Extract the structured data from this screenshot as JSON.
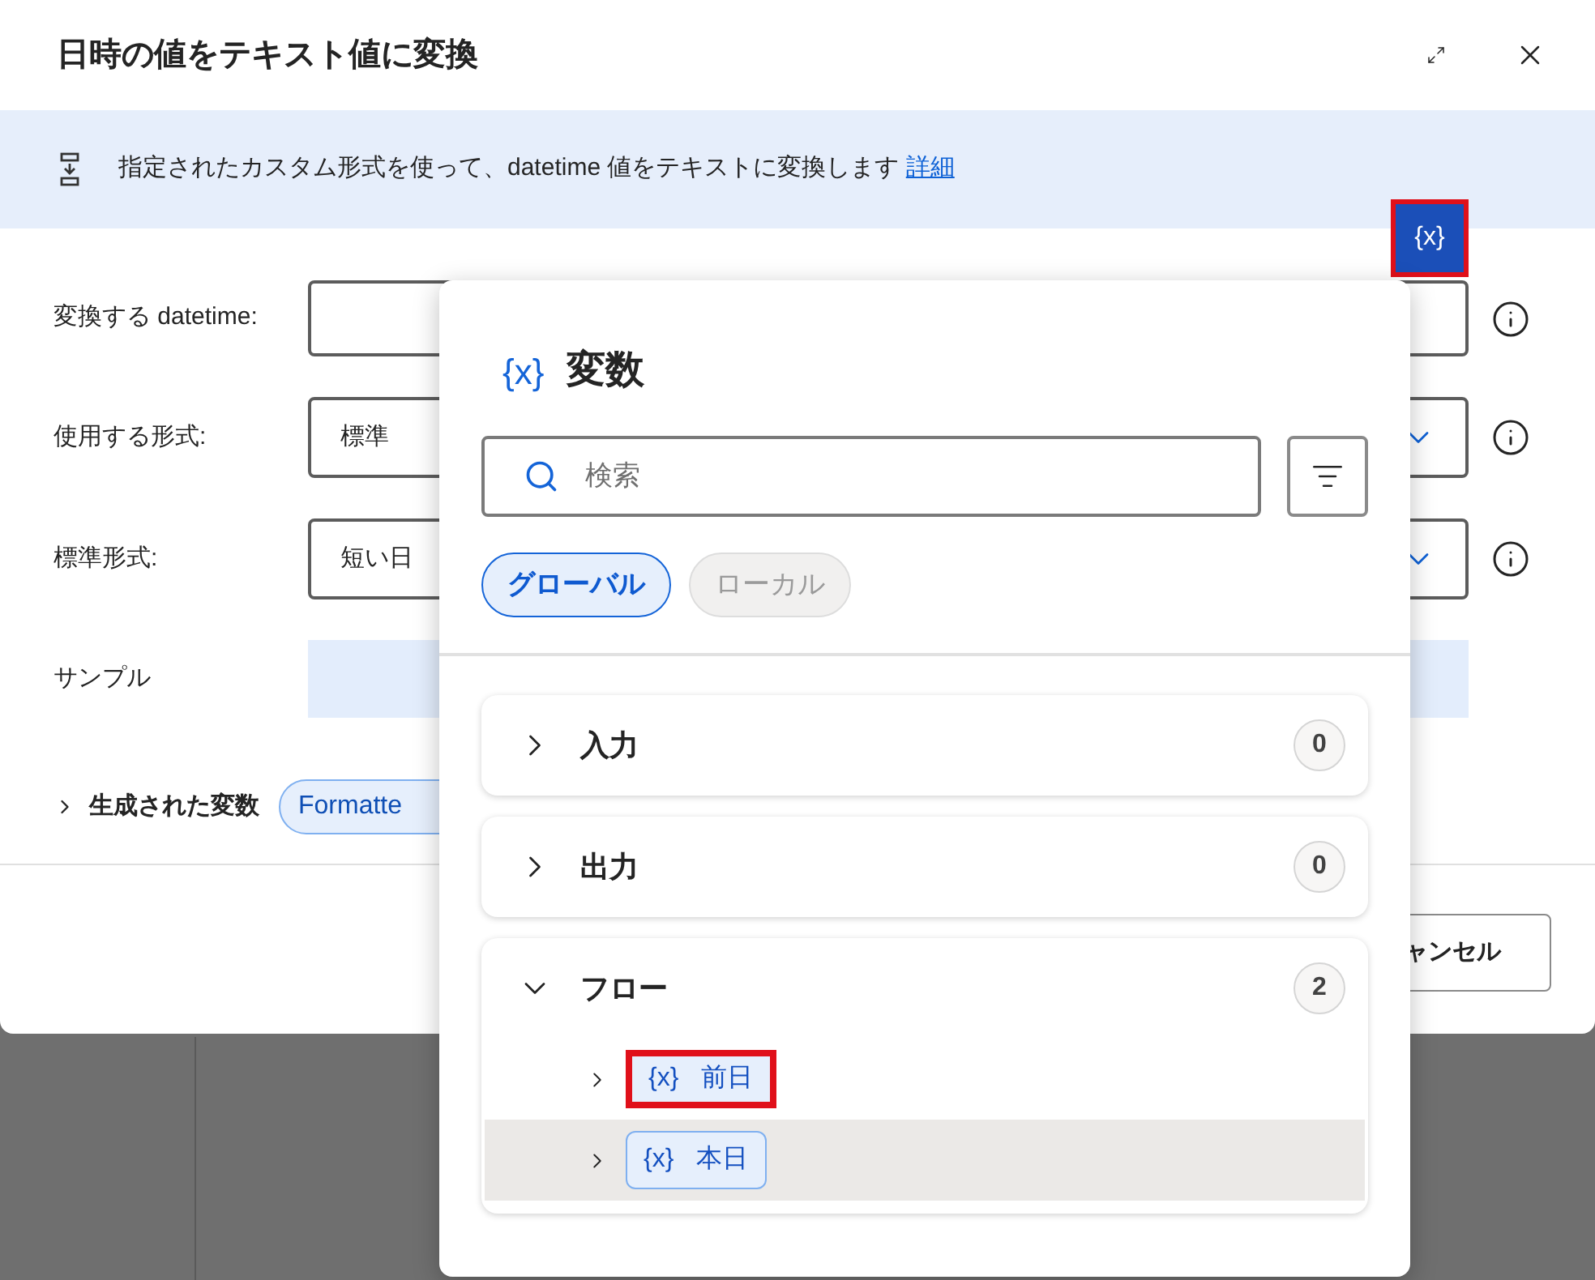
{
  "dialog": {
    "title": "日時の値をテキスト値に変換",
    "description": "指定されたカスタム形式を使って、datetime 値をテキストに変換します",
    "details_link": "詳細",
    "fields": [
      {
        "kind": "text",
        "label": "変換する datetime:"
      },
      {
        "kind": "dropdown",
        "label": "使用する形式:",
        "value": "標準"
      },
      {
        "kind": "dropdown",
        "label": "標準形式:",
        "value": "短い日"
      },
      {
        "kind": "sample",
        "label": "サンプル"
      }
    ],
    "generated_variables": {
      "label": "生成された変数",
      "expanded": false,
      "chip": "Formatte"
    },
    "cancel_button": "ャンセル"
  },
  "variable_button": {
    "text": "{x}",
    "highlighted": true
  },
  "variables_panel": {
    "icon": "{x}",
    "title": "変数",
    "search": {
      "placeholder": "検索"
    },
    "scopes": [
      {
        "label": "グローバル",
        "selected": true
      },
      {
        "label": "ローカル",
        "selected": false
      }
    ],
    "groups": [
      {
        "label": "入力",
        "count": "0",
        "expanded": false
      },
      {
        "label": "出力",
        "count": "0",
        "expanded": false
      },
      {
        "label": "フロー",
        "count": "2",
        "expanded": true,
        "children": [
          {
            "icon": "{x}",
            "name": "前日",
            "highlighted": true,
            "hovered": false
          },
          {
            "icon": "{x}",
            "name": "本日",
            "highlighted": false,
            "hovered": true
          }
        ]
      }
    ]
  }
}
